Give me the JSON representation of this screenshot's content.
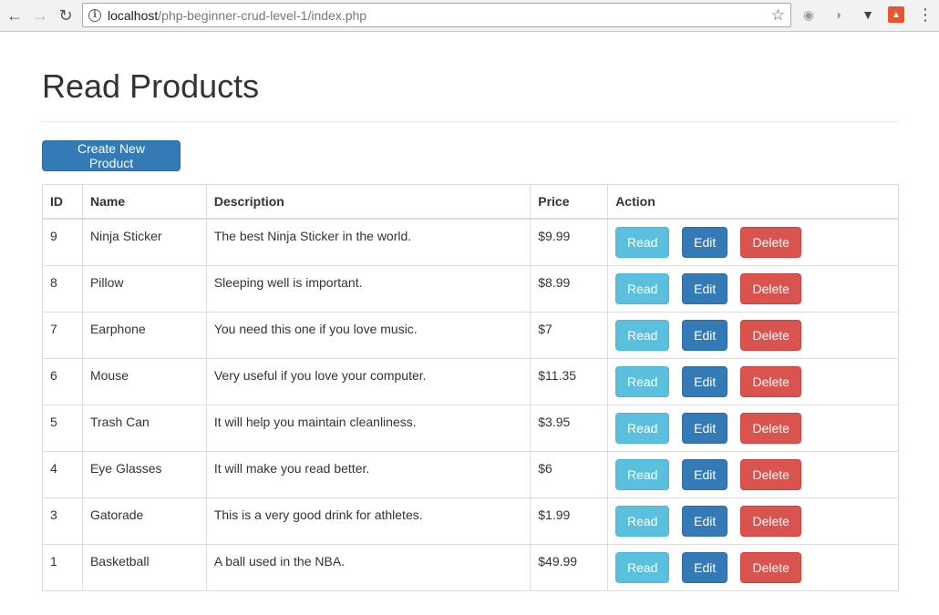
{
  "browser": {
    "url_host": "localhost",
    "url_path": "/php-beginner-crud-level-1/index.php",
    "icons": {
      "back": "back-arrow-icon",
      "forward": "forward-arrow-icon",
      "reload": "reload-icon",
      "info": "info-icon",
      "star": "star-icon",
      "menu": "kebab-menu-icon"
    }
  },
  "page": {
    "title": "Read Products",
    "create_button_label": "Create New Product"
  },
  "table": {
    "headers": {
      "id": "ID",
      "name": "Name",
      "description": "Description",
      "price": "Price",
      "action": "Action"
    },
    "rows": [
      {
        "id": "9",
        "name": "Ninja Sticker",
        "description": "The best Ninja Sticker in the world.",
        "price": "$9.99"
      },
      {
        "id": "8",
        "name": "Pillow",
        "description": "Sleeping well is important.",
        "price": "$8.99"
      },
      {
        "id": "7",
        "name": "Earphone",
        "description": "You need this one if you love music.",
        "price": "$7"
      },
      {
        "id": "6",
        "name": "Mouse",
        "description": "Very useful if you love your computer.",
        "price": "$11.35"
      },
      {
        "id": "5",
        "name": "Trash Can",
        "description": "It will help you maintain cleanliness.",
        "price": "$3.95"
      },
      {
        "id": "4",
        "name": "Eye Glasses",
        "description": "It will make you read better.",
        "price": "$6"
      },
      {
        "id": "3",
        "name": "Gatorade",
        "description": "This is a very good drink for athletes.",
        "price": "$1.99"
      },
      {
        "id": "1",
        "name": "Basketball",
        "description": "A ball used in the NBA.",
        "price": "$49.99"
      }
    ],
    "actions": {
      "read_label": "Read",
      "edit_label": "Edit",
      "delete_label": "Delete"
    }
  },
  "colors": {
    "primary": "#337ab7",
    "info": "#5bc0de",
    "danger": "#d9534f"
  }
}
